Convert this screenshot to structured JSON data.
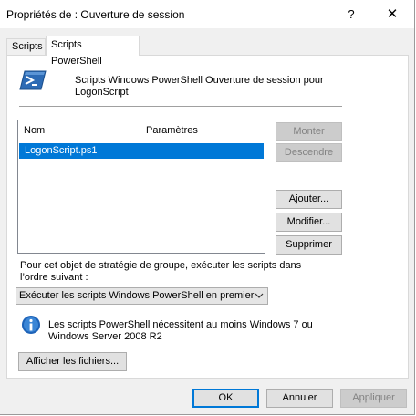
{
  "window": {
    "title": "Propriétés de : Ouverture de session",
    "help_glyph": "?",
    "close_glyph": "✕"
  },
  "tabs": [
    {
      "label": "Scripts",
      "selected": false
    },
    {
      "label": "Scripts PowerShell",
      "selected": true
    }
  ],
  "header": {
    "icon": "powershell-icon",
    "description": "Scripts Windows PowerShell Ouverture de session pour LogonScript"
  },
  "list": {
    "columns": [
      "Nom",
      "Paramètres"
    ],
    "rows": [
      {
        "name": "LogonScript.ps1",
        "params": "",
        "selected": true
      }
    ]
  },
  "side_buttons": {
    "monter": "Monter",
    "descendre": "Descendre",
    "ajouter": "Ajouter...",
    "modifier": "Modifier...",
    "supprimer": "Supprimer"
  },
  "order": {
    "label": "Pour cet objet de stratégie de groupe, exécuter les scripts dans l’ordre suivant :",
    "selected": "Exécuter les scripts Windows PowerShell en premier"
  },
  "info": {
    "icon": "info-icon",
    "text": "Les scripts PowerShell nécessitent au moins Windows 7 ou Windows Server 2008 R2"
  },
  "afficher_label": "Afficher les fichiers...",
  "footer": {
    "ok": "OK",
    "annuler": "Annuler",
    "appliquer": "Appliquer"
  },
  "colors": {
    "selection": "#0078d7",
    "dialog_bg": "#f0f0f0"
  }
}
